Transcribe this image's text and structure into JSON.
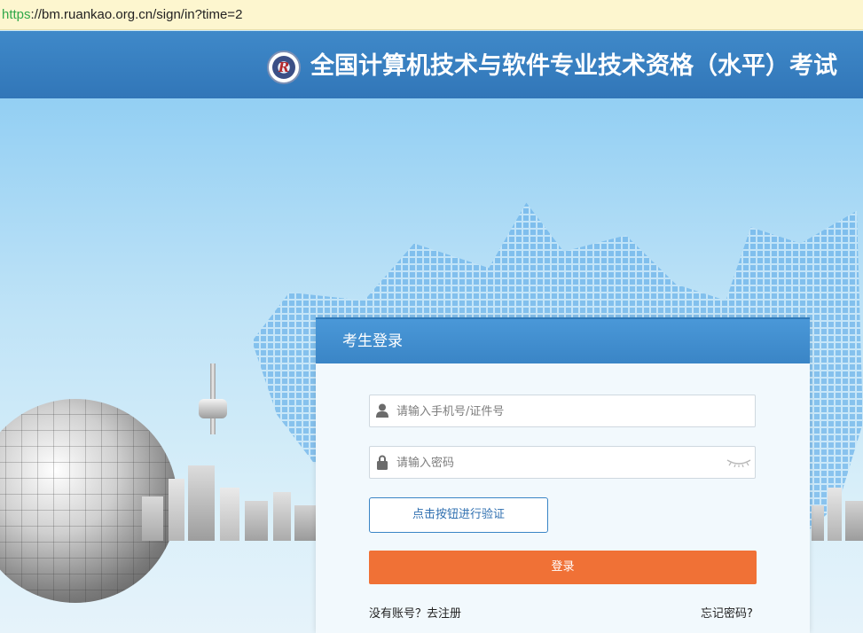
{
  "browser": {
    "url_scheme": "https",
    "url_rest": "://bm.ruankao.org.cn/sign/in?time=2"
  },
  "header": {
    "title": "全国计算机技术与软件专业技术资格（水平）考试",
    "logo_icon": "exam-authority-seal-logo",
    "background_color": "#3a82c4"
  },
  "login": {
    "title": "考生登录",
    "account_placeholder": "请输入手机号/证件号",
    "account_value": "",
    "password_placeholder": "请输入密码",
    "password_value": "",
    "verify_label": "点击按钮进行验证",
    "submit_label": "登录",
    "register_link": "没有账号？去注册",
    "forgot_link": "忘记密码?",
    "accent_color": "#3a85c6",
    "submit_color": "#f07136"
  }
}
